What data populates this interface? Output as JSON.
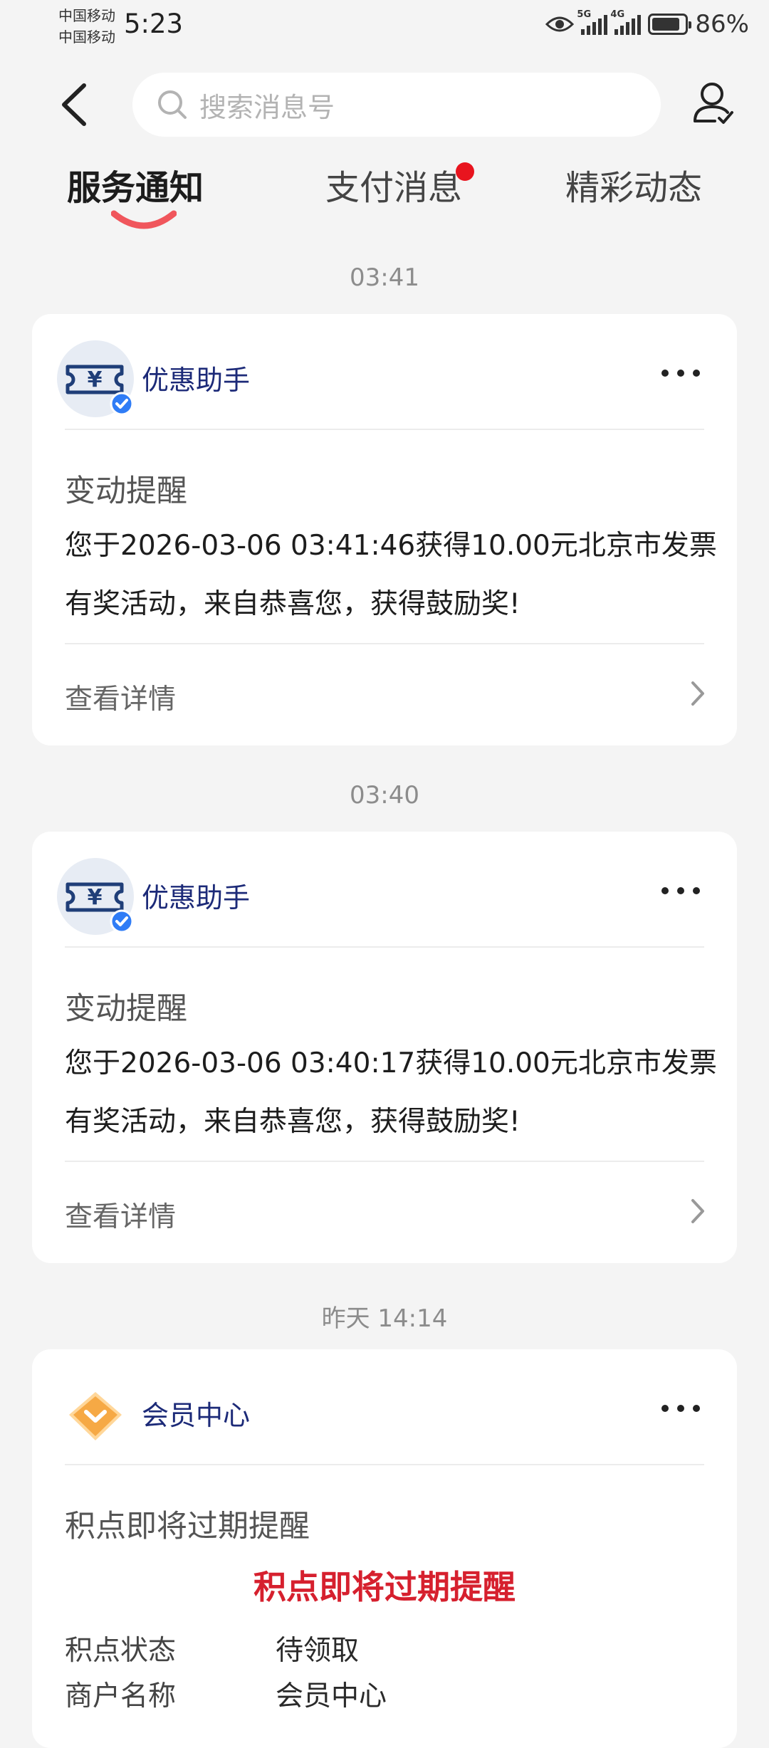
{
  "status_bar": {
    "carrier_1": "中国移动",
    "carrier_2": "中国移动",
    "time": "5:23",
    "battery": "86%",
    "net_1": "5G",
    "net_2": "4G"
  },
  "search": {
    "placeholder": "搜索消息号"
  },
  "tabs": [
    {
      "label": "服务通知",
      "active": true
    },
    {
      "label": "支付消息",
      "badge": true
    },
    {
      "label": "精彩动态"
    }
  ],
  "messages": [
    {
      "time": "03:41",
      "sender": "优惠助手",
      "title": "变动提醒",
      "body": "您于2026-03-06 03:41:46获得10.00元北京市发票有奖活动，来自恭喜您，获得鼓励奖!",
      "action": "查看详情"
    },
    {
      "time": "03:40",
      "sender": "优惠助手",
      "title": "变动提醒",
      "body": "您于2026-03-06 03:40:17获得10.00元北京市发票有奖活动，来自恭喜您，获得鼓励奖!",
      "action": "查看详情"
    },
    {
      "time": "昨天 14:14",
      "sender": "会员中心",
      "title": "积点即将过期提醒",
      "headline": "积点即将过期提醒",
      "fields": [
        {
          "key": "积点状态",
          "value": "待领取"
        },
        {
          "key": "商户名称",
          "value": "会员中心"
        }
      ]
    }
  ],
  "colors": {
    "accent_red": "#e8141e",
    "sender_blue": "#1c2a78",
    "headline_red": "#d6202e",
    "tab_underline": "#f0565c"
  }
}
